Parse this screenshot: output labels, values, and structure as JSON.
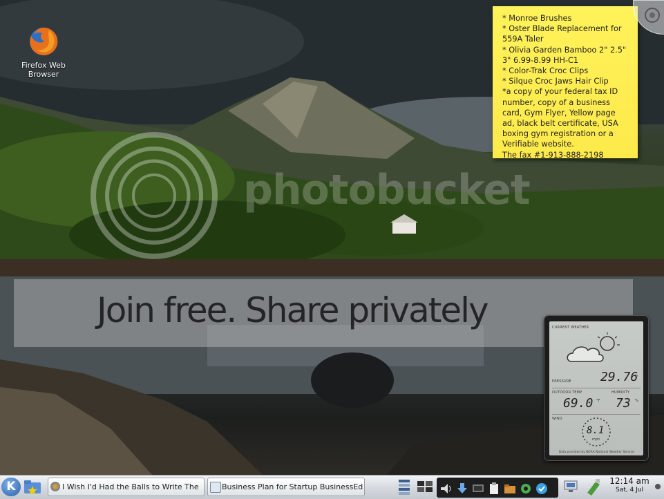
{
  "desktop": {
    "icons": [
      {
        "label": "Firefox Web Browser"
      }
    ]
  },
  "sticky_note": {
    "lines": [
      "* Monroe Brushes",
      "* Oster Blade Replacement for 559A Taler",
      "* Olivia Garden Bamboo 2\" 2.5\" 3\" 6.99-8.99 HH-C1",
      "* Color-Trak Croc Clips",
      "* Silque Croc Jaws Hair Clip",
      "*a copy of your federal tax ID number, copy of a business card, Gym Flyer, Yellow page ad, black belt certificate, USA boxing gym registration or a Verifiable website.",
      "The fax #1-913-888-2198"
    ]
  },
  "watermark": {
    "brand": "photobucket",
    "banner": "Join free. Share privately"
  },
  "weather_widget": {
    "title": "CURRENT WEATHER",
    "pressure_label": "PRESSURE",
    "pressure_value": "29.76",
    "pressure_unit": "in",
    "outdoor_temp_label": "OUTDOOR TEMP",
    "outdoor_temp_value": "69.0",
    "temp_unit": "°F",
    "humidity_label": "HUMIDITY",
    "humidity_value": "73",
    "humidity_unit": "%",
    "wind_label": "WIND",
    "wind_value": "8.1",
    "wind_unit": "mph",
    "footer": "Data provided by NOAA National Weather Service"
  },
  "taskbar": {
    "launcher_glyph": "K",
    "tasks": [
      {
        "label": "I Wish I'd Had the Balls to Write The"
      },
      {
        "label": "Business Plan for Startup BusinessEd"
      }
    ],
    "tray_icons": [
      "pager-icon",
      "desktop-grid-icon",
      "volume-icon",
      "download-icon",
      "display-icon",
      "clipboard-icon",
      "folder-icon",
      "gear-icon",
      "update-icon",
      "network-icon",
      "power-icon"
    ],
    "clock": {
      "time": "12:14 am",
      "date": "Sat, 4 Jul"
    }
  },
  "colors": {
    "note": "#fde94a",
    "taskbar": "#d9dde2",
    "accent": "#2d5fa4"
  }
}
